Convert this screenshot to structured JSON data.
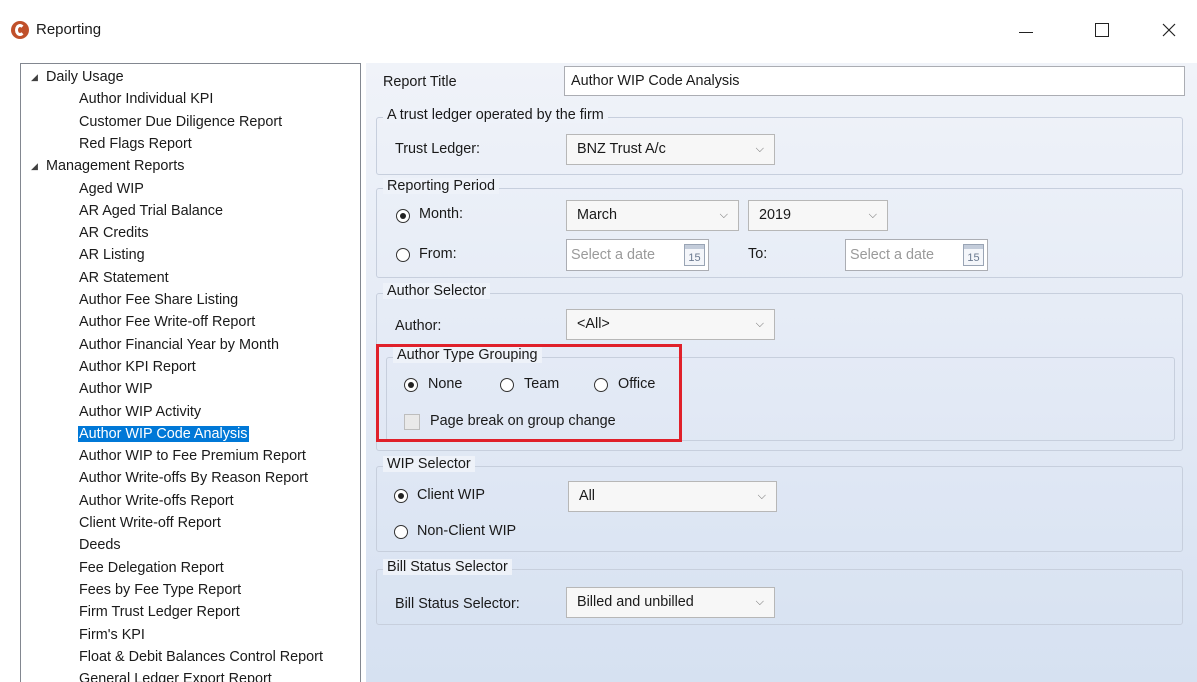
{
  "window": {
    "title": "Reporting",
    "icon": "app-logo-icon",
    "minimize": "—",
    "maximize": "☐",
    "close": "✕"
  },
  "tree": {
    "items": [
      {
        "label": "Daily Usage",
        "type": "group",
        "expanded": true
      },
      {
        "label": "Author Individual KPI",
        "type": "leaf"
      },
      {
        "label": "Customer Due Diligence Report",
        "type": "leaf"
      },
      {
        "label": "Red Flags Report",
        "type": "leaf"
      },
      {
        "label": "Management Reports",
        "type": "group",
        "expanded": true
      },
      {
        "label": "Aged WIP",
        "type": "leaf"
      },
      {
        "label": "AR Aged Trial Balance",
        "type": "leaf"
      },
      {
        "label": "AR Credits",
        "type": "leaf"
      },
      {
        "label": "AR Listing",
        "type": "leaf"
      },
      {
        "label": "AR Statement",
        "type": "leaf"
      },
      {
        "label": "Author Fee Share Listing",
        "type": "leaf"
      },
      {
        "label": "Author Fee Write-off Report",
        "type": "leaf"
      },
      {
        "label": "Author Financial Year by Month",
        "type": "leaf"
      },
      {
        "label": "Author KPI Report",
        "type": "leaf"
      },
      {
        "label": "Author WIP",
        "type": "leaf"
      },
      {
        "label": "Author WIP Activity",
        "type": "leaf"
      },
      {
        "label": "Author WIP Code Analysis",
        "type": "leaf",
        "selected": true
      },
      {
        "label": "Author WIP to Fee Premium Report",
        "type": "leaf"
      },
      {
        "label": "Author Write-offs By Reason Report",
        "type": "leaf"
      },
      {
        "label": "Author Write-offs Report",
        "type": "leaf"
      },
      {
        "label": "Client Write-off Report",
        "type": "leaf"
      },
      {
        "label": "Deeds",
        "type": "leaf"
      },
      {
        "label": "Fee Delegation Report",
        "type": "leaf"
      },
      {
        "label": "Fees by Fee Type Report",
        "type": "leaf"
      },
      {
        "label": "Firm Trust Ledger Report",
        "type": "leaf"
      },
      {
        "label": "Firm's KPI",
        "type": "leaf"
      },
      {
        "label": "Float & Debit Balances Control Report",
        "type": "leaf"
      },
      {
        "label": "General Ledger Export Report",
        "type": "leaf"
      }
    ]
  },
  "form": {
    "report_title": {
      "label": "Report Title",
      "value": "Author WIP Code Analysis"
    },
    "trust_ledger": {
      "group_title": "A trust ledger operated by the firm",
      "label": "Trust Ledger:",
      "value": "BNZ Trust A/c"
    },
    "reporting_period": {
      "group_title": "Reporting Period",
      "month_label": "Month:",
      "month_value": "March",
      "year_value": "2019",
      "from_label": "From:",
      "from_placeholder": "Select a date",
      "to_label": "To:",
      "to_placeholder": "Select a date",
      "calendar_day": "15",
      "selected": "month"
    },
    "author_selector": {
      "group_title": "Author Selector",
      "label": "Author:",
      "value": "<All>"
    },
    "author_type_grouping": {
      "group_title": "Author Type Grouping",
      "options": [
        "None",
        "Team",
        "Office"
      ],
      "selected": "None",
      "page_break_label": "Page break on group change",
      "page_break_checked": false
    },
    "wip_selector": {
      "group_title": "WIP Selector",
      "client_label": "Client WIP",
      "client_value": "All",
      "nonclient_label": "Non-Client WIP",
      "selected": "client"
    },
    "bill_status": {
      "group_title": "Bill Status Selector",
      "label": "Bill Status Selector:",
      "value": "Billed and unbilled"
    }
  },
  "colors": {
    "selection": "#0078d7",
    "highlight_border": "#e0202a",
    "app_icon": "#c0502a"
  }
}
